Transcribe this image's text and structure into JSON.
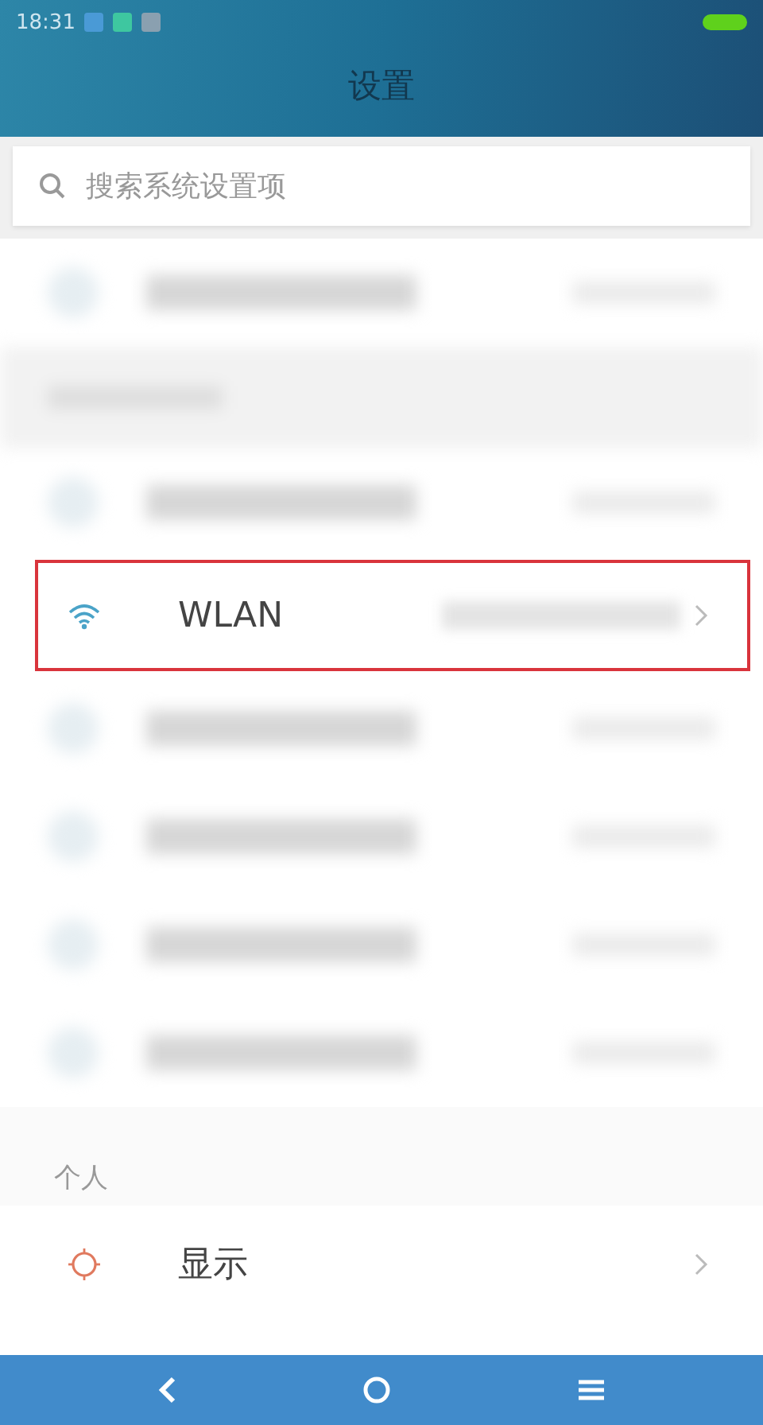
{
  "status_bar": {
    "time": "18:31"
  },
  "header": {
    "title": "设置"
  },
  "search": {
    "placeholder": "搜索系统设置项"
  },
  "items": [
    {
      "kind": "blurred"
    },
    {
      "kind": "section_blurred"
    },
    {
      "kind": "blurred"
    },
    {
      "kind": "network",
      "label": "WLAN",
      "highlighted": true
    },
    {
      "kind": "blurred"
    },
    {
      "kind": "blurred"
    },
    {
      "kind": "blurred"
    },
    {
      "kind": "blurred"
    },
    {
      "kind": "section",
      "label": "个人"
    },
    {
      "kind": "display",
      "label": "显示",
      "highlighted": false
    }
  ]
}
